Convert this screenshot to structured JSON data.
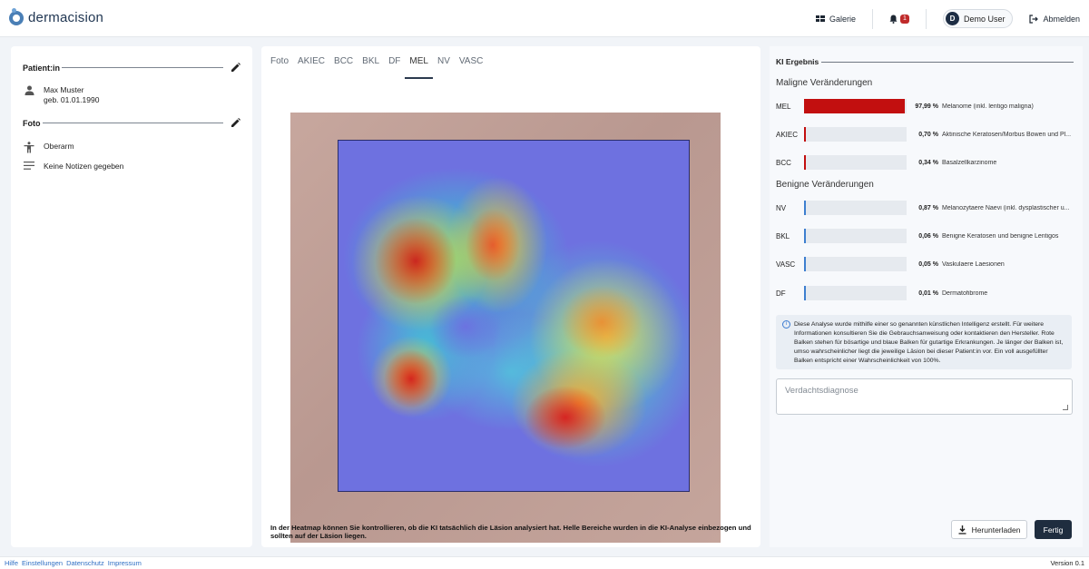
{
  "app": {
    "logo_text": "dermacision"
  },
  "nav": {
    "gallery_label": "Galerie",
    "notifications_count": "1",
    "user_initial": "D",
    "user_name": "Demo User",
    "logout_label": "Abmelden"
  },
  "patient": {
    "section_title": "Patient:in",
    "name": "Max Muster",
    "birth": "geb. 01.01.1990"
  },
  "photo_section": {
    "section_title": "Foto",
    "location": "Oberarm",
    "notes": "Keine Notizen gegeben"
  },
  "tabs": [
    {
      "label": "Foto"
    },
    {
      "label": "AKIEC"
    },
    {
      "label": "BCC"
    },
    {
      "label": "BKL"
    },
    {
      "label": "DF"
    },
    {
      "label": "MEL",
      "active": true
    },
    {
      "label": "NV"
    },
    {
      "label": "VASC"
    }
  ],
  "heatmap_caption": "In der Heatmap können Sie kontrollieren, ob die KI tatsächlich die Läsion analysiert hat. Helle Bereiche wurden in die KI-Analyse einbezogen und sollten auf der Läsion liegen.",
  "ki": {
    "title": "KI Ergebnis",
    "malignant_title": "Maligne Veränderungen",
    "benign_title": "Benigne Veränderungen",
    "malignant": [
      {
        "code": "MEL",
        "percent_label": "97,99 %",
        "value": 97.99,
        "desc": "Melanome (inkl. lentigo maligna)"
      },
      {
        "code": "AKIEC",
        "percent_label": "0,70 %",
        "value": 0.7,
        "desc": "Aktinische Keratosen/Morbus Bowen und Pl..."
      },
      {
        "code": "BCC",
        "percent_label": "0,34 %",
        "value": 0.34,
        "desc": "Basalzellkarzinome"
      }
    ],
    "benign": [
      {
        "code": "NV",
        "percent_label": "0,87 %",
        "value": 0.87,
        "desc": "Melanozytaere Naevi (inkl. dysplastischer u..."
      },
      {
        "code": "BKL",
        "percent_label": "0,06 %",
        "value": 0.06,
        "desc": "Benigne Keratosen und benigne Lentigos"
      },
      {
        "code": "VASC",
        "percent_label": "0,05 %",
        "value": 0.05,
        "desc": "Vaskulaere Laesionen"
      },
      {
        "code": "DF",
        "percent_label": "0,01 %",
        "value": 0.01,
        "desc": "Dermatofibrome"
      }
    ],
    "colors": {
      "malignant": "#c20f0f",
      "benign": "#3d7fd0"
    },
    "info_text": "Diese Analyse wurde mithilfe einer so genannten künstlichen Intelligenz erstellt. Für weitere Informationen konsultieren Sie die Gebrauchsanweisung oder kontaktieren den Hersteller. Rote Balken stehen für bösartige und blaue Balken für gutartige Erkrankungen. Je länger der Balken ist, umso wahrscheinlicher liegt die jeweilige Läsion bei dieser Patient:in vor. Ein voll ausgefüllter Balken entspricht einer Wahrscheinlichkeit von 100%.",
    "diagnosis_placeholder": "Verdachtsdiagnose",
    "download_label": "Herunterladen",
    "done_label": "Fertig"
  },
  "footer": {
    "links": [
      "Hilfe",
      "Einstellungen",
      "Datenschutz",
      "Impressum"
    ],
    "version": "Version 0.1"
  }
}
